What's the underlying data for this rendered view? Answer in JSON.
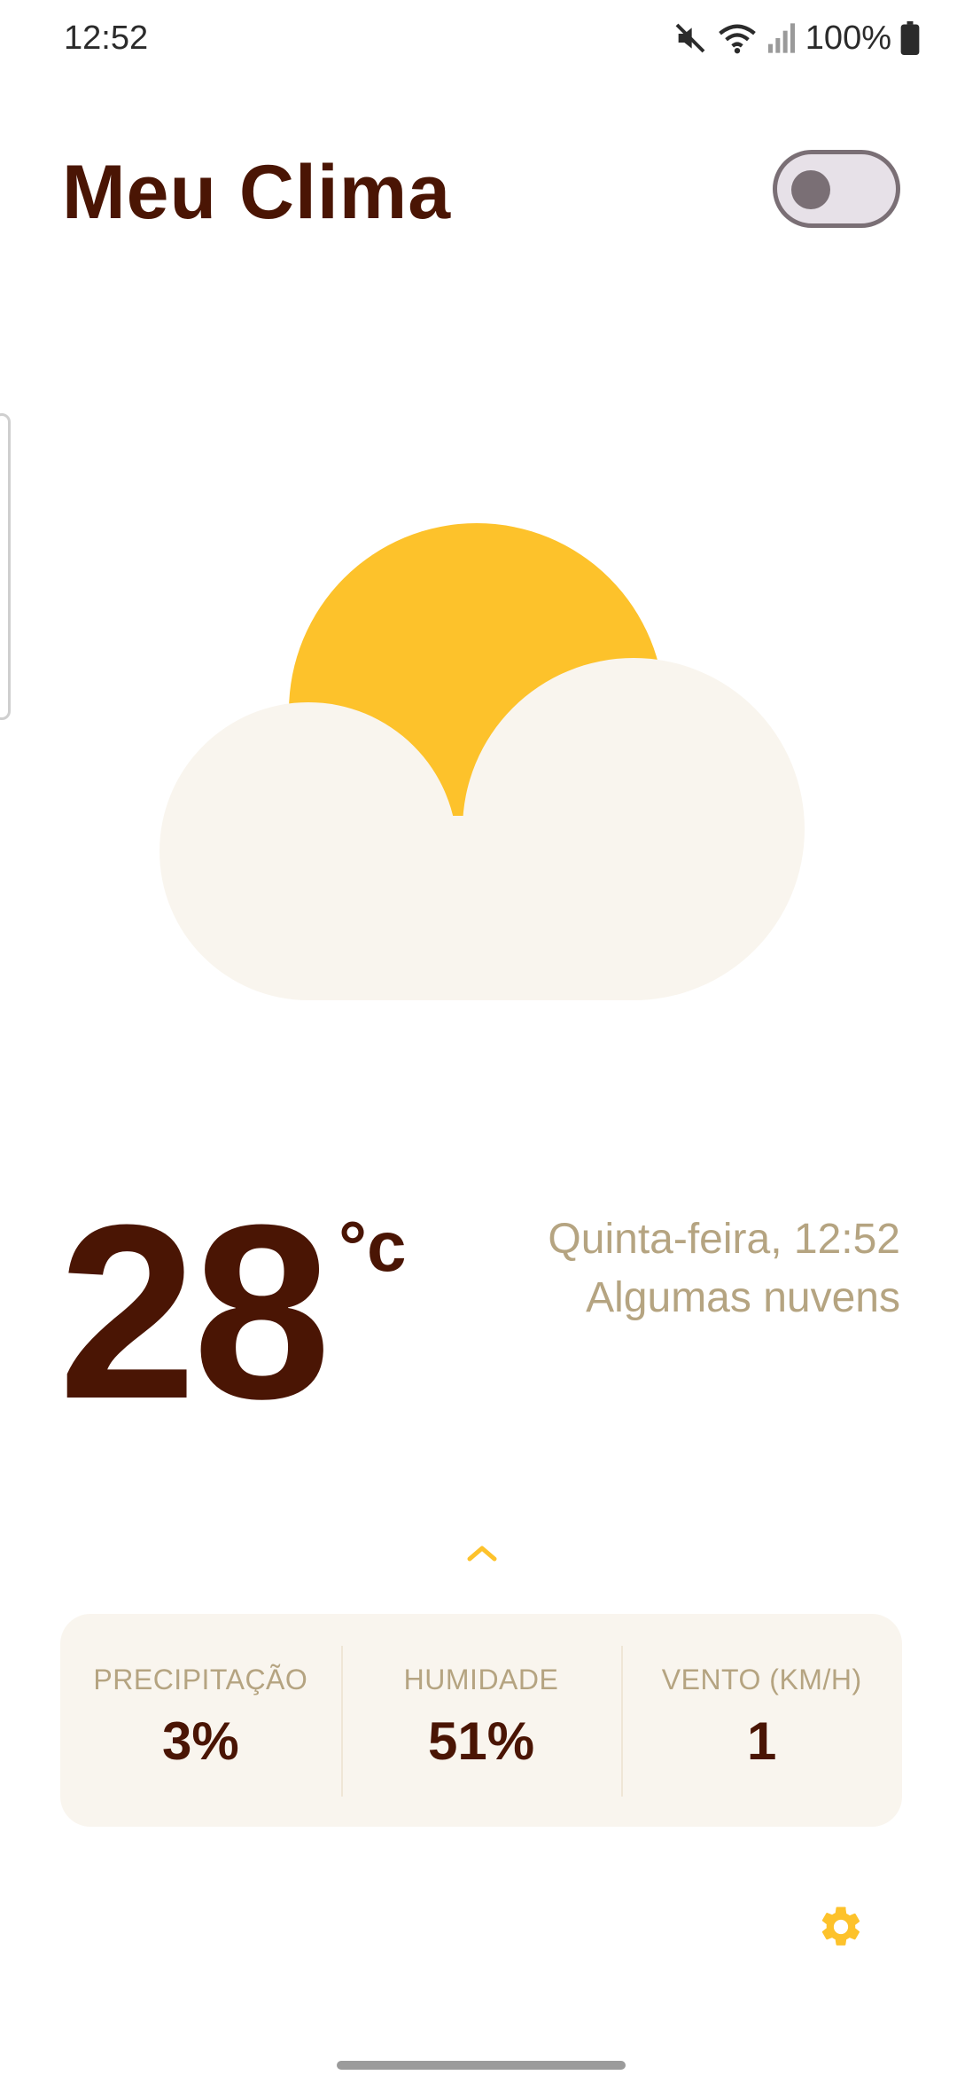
{
  "status_bar": {
    "time": "12:52",
    "battery": "100%",
    "icons": [
      "mute-icon",
      "wifi-icon",
      "signal-icon",
      "battery-icon"
    ]
  },
  "header": {
    "title": "Meu Clima",
    "toggle_state": "off"
  },
  "weather": {
    "icon": "partly-cloudy-icon",
    "temperature": "28",
    "unit": "°c",
    "day_time": "Quinta-feira, 12:52",
    "condition": "Algumas nuvens"
  },
  "stats": [
    {
      "label": "PRECIPITAÇÃO",
      "value": "3%"
    },
    {
      "label": "HUMIDADE",
      "value": "51%"
    },
    {
      "label": "VENTO (KM/H)",
      "value": "1"
    }
  ],
  "colors": {
    "primary_text": "#4a1504",
    "secondary_text": "#b5a481",
    "sun": "#fdc22b",
    "cloud": "#f9f5ee",
    "accent": "#fdc22b"
  },
  "settings_icon": "gear-icon"
}
